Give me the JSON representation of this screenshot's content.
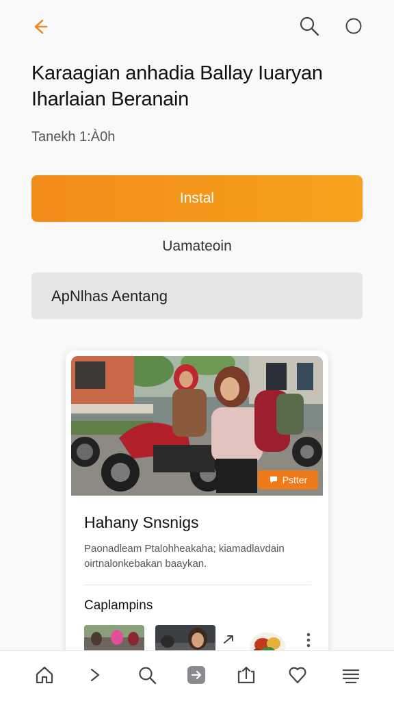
{
  "header": {
    "back_icon": "arrow-left-icon",
    "search_icon": "search-icon",
    "circle_icon": "circle-icon"
  },
  "main": {
    "title_line1": "Karaagian anhadia Ballay Iuaryan",
    "title_line2": "Iharlaian Beranain",
    "date": "Tanekh 1:À0h",
    "install_label": "Instal",
    "secondary_label": "Uamateoin",
    "about_label": "ApNlhas Aentang"
  },
  "card": {
    "badge_label": "Pstter",
    "title": "Hahany Snsnigs",
    "desc_line1": "Paonadleam Ptalohheakaha; kiamadlavdain",
    "desc_line2": "oirtnalonkebakan baaykan.",
    "subtitle": "Caplampins"
  },
  "bottom_nav": {
    "icons": [
      "home-icon",
      "chevron-right-icon",
      "search-icon",
      "add-square-icon",
      "upload-icon",
      "heart-icon",
      "stack-icon"
    ]
  },
  "colors": {
    "accent": "#f28b1a",
    "accent_end": "#f6a21e",
    "about_bg": "#e4e5e7"
  }
}
